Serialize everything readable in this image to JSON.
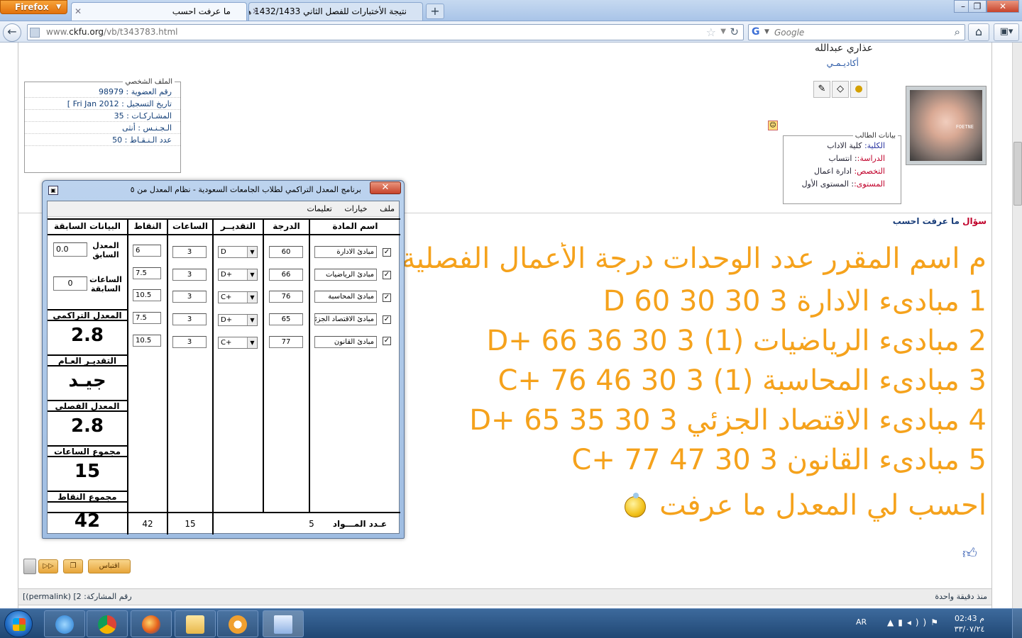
{
  "browser": {
    "app_button": "Firefox",
    "tabs": [
      {
        "title": "ما عرفت احسب",
        "active": true
      },
      {
        "title": "نتيجة الأختبارات للفصل الثاني 1432/1433 هـ",
        "active": false
      }
    ],
    "url_host": "www.",
    "url_domain": "ckfu.org",
    "url_path": "/vb/t343783.html",
    "search_placeholder": "Google"
  },
  "profile": {
    "username": "عذاري عبدالله",
    "user_title": "أكاديـمـي",
    "legend": "الملف الشخصي",
    "lines": [
      "رقم العضوية : 98979",
      "تاريخ التسجيل : Fri Jan 2012 ]",
      "المشـاركـات : 35",
      "الـجـنـس : أنثى",
      "عدد الـنـقـاط : 50"
    ]
  },
  "student": {
    "legend": "بيانات الطالب",
    "rows": [
      {
        "key": "الكلية:",
        "value": "كلية الاداب"
      },
      {
        "key": "الدراسة:",
        "value": ": انتساب"
      },
      {
        "key": "التخصص:",
        "value": "ادارة اعمال"
      },
      {
        "key": "المستوى:",
        "value": ": المستوى الأول"
      }
    ],
    "avatar_text": "FOETNE"
  },
  "post": {
    "title_prefix": "سؤال",
    "title": "ما عرفت احسب",
    "lines": [
      "م اسم المقرر عدد الوحدات درجة الأعمال الفصلية درجة",
      "1 مبادىء الادارة 3 30 30 60 D",
      "2 مبادىء الرياضيات (1) 3 30 36 66 +D",
      "3 مبادىء المحاسبة (1) 3 30 46 76 +C",
      "4 مبادىء الاقتصاد الجزئي 3 30 35 65 +D",
      "5 مبادىء القانون 3 30 47 77 +C",
      "احسب لي المعدل ما عرفت"
    ],
    "quote_button": "اقتباس",
    "footer_left": "[(permalink) [2 :رقم المشاركة",
    "footer_right": "منذ دقيقة واحدة"
  },
  "calculator": {
    "title": "برنامج المعدل التراكمي لطلاب الجامعات السعودية - نظام المعدل من ٥",
    "menu": [
      "ملف",
      "خيارات",
      "تعليمات"
    ],
    "headers": {
      "course": "اسم المادة",
      "score": "الدرجة",
      "grade": "التقديــر",
      "hours": "الساعات",
      "points": "النقاط",
      "previous": "البيانات السابقة"
    },
    "rows": [
      {
        "course": "مبادئ الادارة",
        "score": "60",
        "grade": "D",
        "hours": "3",
        "points": "6"
      },
      {
        "course": "مبادئ الرياضيات",
        "score": "66",
        "grade": "D+",
        "hours": "3",
        "points": "7.5"
      },
      {
        "course": "مبادئ المحاسبة",
        "score": "76",
        "grade": "C+",
        "hours": "3",
        "points": "10.5"
      },
      {
        "course": "مبادئ الاقتصاد الجزئي",
        "score": "65",
        "grade": "D+",
        "hours": "3",
        "points": "7.5"
      },
      {
        "course": "مبادئ القانون",
        "score": "77",
        "grade": "C+",
        "hours": "3",
        "points": "10.5"
      }
    ],
    "prev_gpa_label": "المعدل السابق",
    "prev_gpa": "0.0",
    "prev_hours_label": "الساعات السابقة",
    "prev_hours": "0",
    "cumulative_label": "المعدل التراكمي",
    "cumulative": "2.8",
    "overall_label": "التقديـر العـام",
    "overall": "جيـد",
    "semester_label": "المعدل الفصلي",
    "semester": "2.8",
    "hours_total_label": "مجموع الساعات",
    "hours_total": "15",
    "points_total_label": "مجموع النقاط",
    "points_total": "42",
    "count_label": "عـدد المـــواد",
    "count": "5",
    "hours_sum": "15",
    "points_sum": "42"
  },
  "taskbar": {
    "lang": "AR",
    "time": "02:43 م",
    "date": "٣٣/٠٧/٢٤"
  }
}
